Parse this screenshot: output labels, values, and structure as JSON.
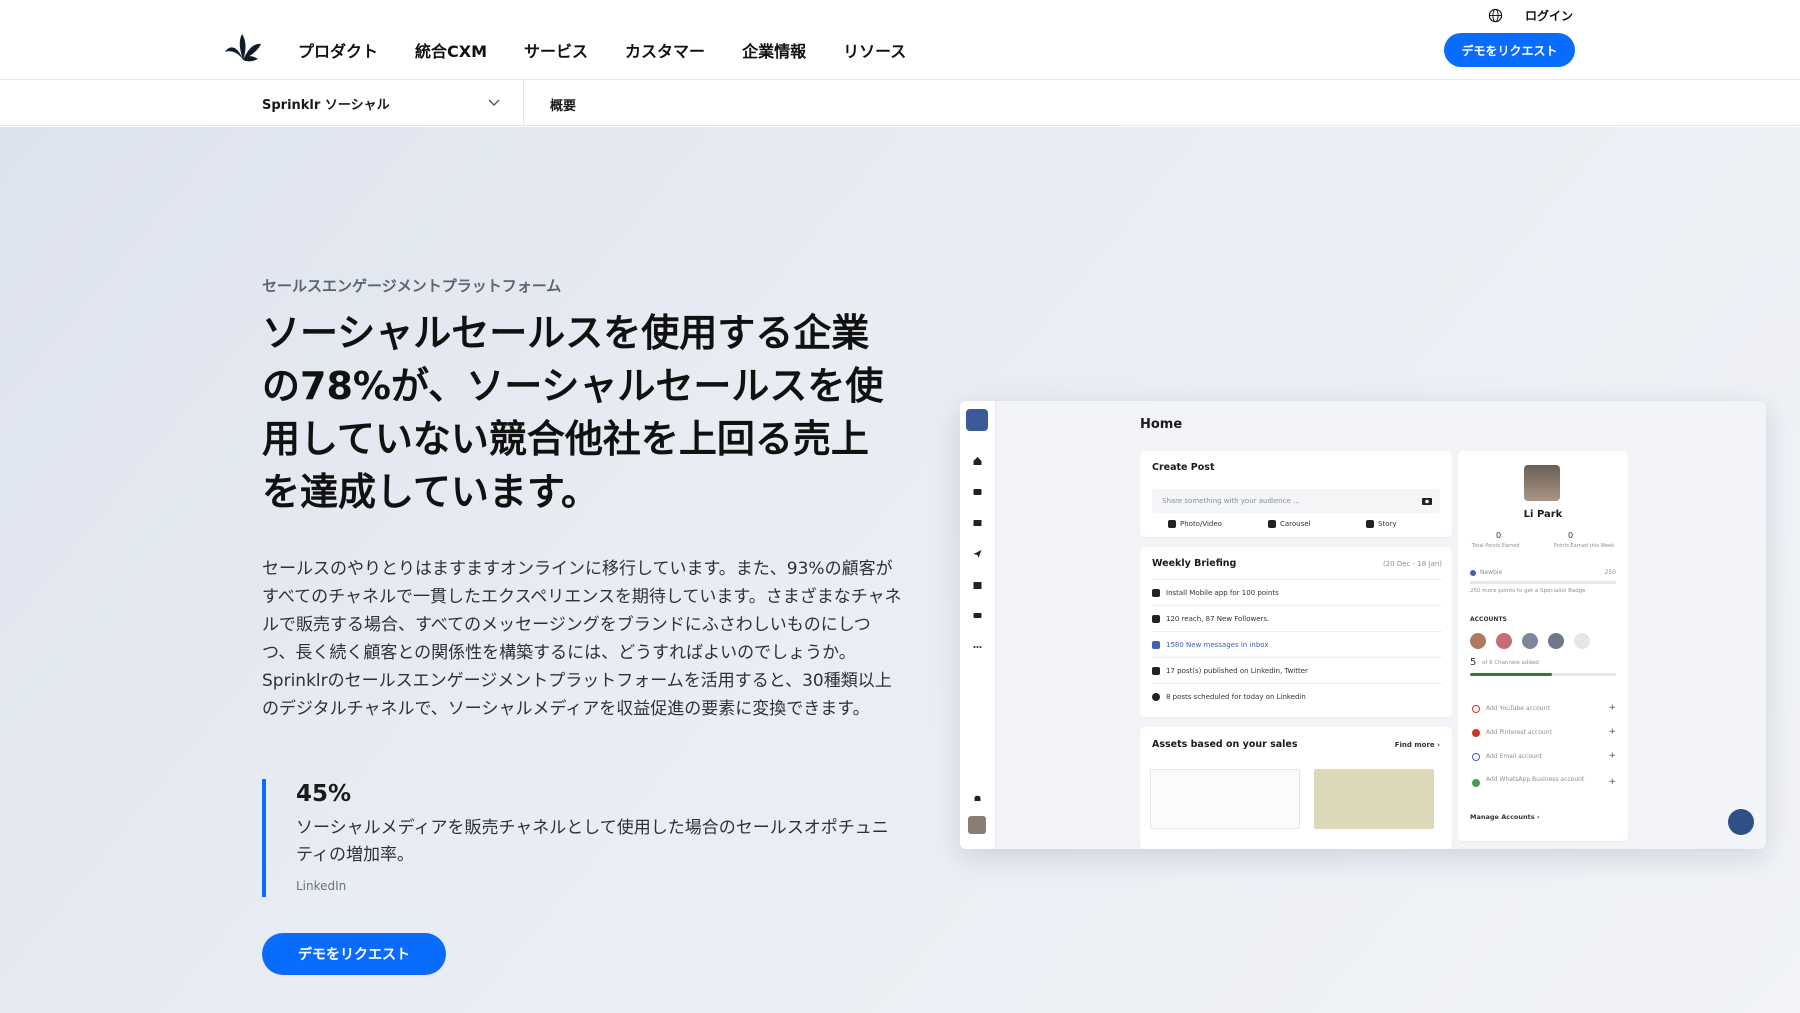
{
  "nav": {
    "logo_icon": "sprinklr-logo-icon",
    "menu": [
      "プロダクト",
      "統合CXM",
      "サービス",
      "カスタマー",
      "企業情報",
      "リソース"
    ],
    "login": "ログイン",
    "globe_icon": "globe-icon",
    "cta": "デモをリクエスト",
    "accent": "#0a6bff"
  },
  "subnav": {
    "product": "Sprinklr ソーシャル",
    "overview": "概要"
  },
  "hero": {
    "eyebrow": "セールスエンゲージメントプラットフォーム",
    "headline": "ソーシャルセールスを使用する企業の78%が、ソーシャルセールスを使用していない競合他社を上回る売上を達成しています。",
    "body": "セールスのやりとりはますますオンラインに移行しています。また、93%の顧客がすべてのチャネルで一貫したエクスペリエンスを期待しています。さまざまなチャネルで販売する場合、すべてのメッセージングをブランドにふさわしいものにしつつ、長く続く顧客との関係性を構築するには、どうすればよいのでしょうか。Sprinklrのセールスエンゲージメントプラットフォームを活用すると、30種類以上のデジタルチャネルで、ソーシャルメディアを収益促進の要素に変換できます。",
    "stat": {
      "value": "45%",
      "description": "ソーシャルメディアを販売チャネルとして使用した場合のセールスオポチュニティの増加率。",
      "source": "LinkedIn"
    },
    "cta": "デモをリクエスト"
  },
  "mockup": {
    "title": "Home",
    "create_post": {
      "title": "Create Post",
      "placeholder": "Share something with your audience ...",
      "actions": [
        "Photo/Video",
        "Carousel",
        "Story"
      ]
    },
    "weekly": {
      "title": "Weekly Briefing",
      "range": "(20 Dec - 18 Jan)",
      "items": [
        "Install Mobile app for 100 points",
        "120 reach, 87 New Followers.",
        "1580 New messages in inbox",
        "17 post(s) published on Linkedin, Twitter",
        "8 posts scheduled for today on Linkedin"
      ]
    },
    "assets": {
      "title": "Assets based on your sales",
      "link": "Find more ›"
    },
    "profile": {
      "name": "Li Park",
      "points_total": "0",
      "points_total_label": "Total Points Earned",
      "points_week": "0",
      "points_week_label": "Points Earned this Week",
      "badge": "Newbie",
      "badge_points": "250",
      "badge_note": "250 more points to get a Specialist Badge",
      "accounts_label": "ACCOUNTS",
      "accounts_count": "5",
      "accounts_note": "of 9 Channels added",
      "accounts_progress": 0.56,
      "add_items": [
        "Add YouTube account",
        "Add Pinterest account",
        "Add Email account",
        "Add WhatsApp Business account"
      ],
      "manage": "Manage Accounts ›"
    }
  }
}
